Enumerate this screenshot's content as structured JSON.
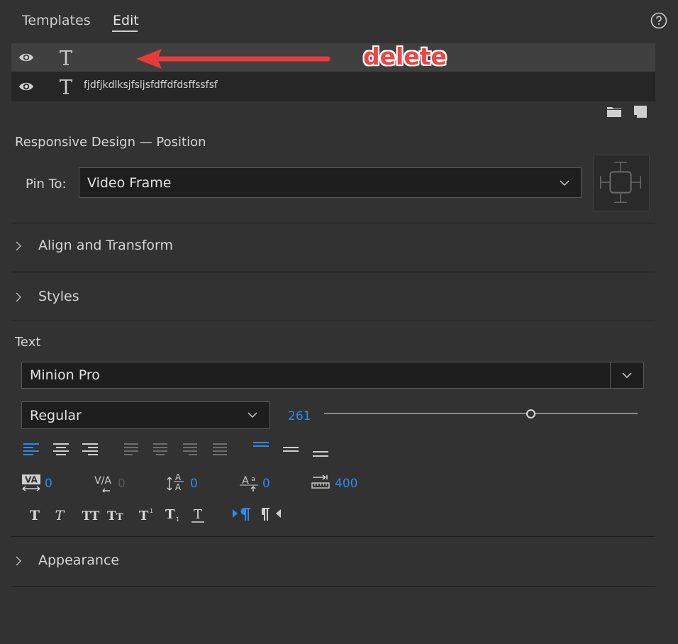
{
  "tabs": [
    {
      "label": "Templates",
      "active": false
    },
    {
      "label": "Edit",
      "active": true
    }
  ],
  "icons": {
    "help": "help-icon",
    "eye": "eye-icon",
    "text_layer": "text-layer-icon",
    "folder": "folder-icon",
    "new_layer": "new-layer-icon"
  },
  "layers": [
    {
      "name": "",
      "selected": true
    },
    {
      "name": "fjdfjkdlksjfsljsfdffdfdsffssfsf",
      "selected": false
    }
  ],
  "annotation": {
    "text": "delete",
    "color": "#f04444"
  },
  "responsive": {
    "heading": "Responsive Design — Position",
    "pin_label": "Pin To:",
    "pin_value": "Video Frame"
  },
  "sections": {
    "align": "Align and Transform",
    "styles": "Styles",
    "text": "Text",
    "appearance": "Appearance"
  },
  "text": {
    "font": "Minion Pro",
    "style": "Regular",
    "size": "261",
    "size_fraction": 0.66,
    "kerning": "0",
    "tracking": "0",
    "leading": "0",
    "baseline_shift": "0",
    "tab_width": "400"
  },
  "colors": {
    "accent": "#2d8ceb",
    "panel_bg": "#323232",
    "field_bg": "#1e1e1e"
  }
}
